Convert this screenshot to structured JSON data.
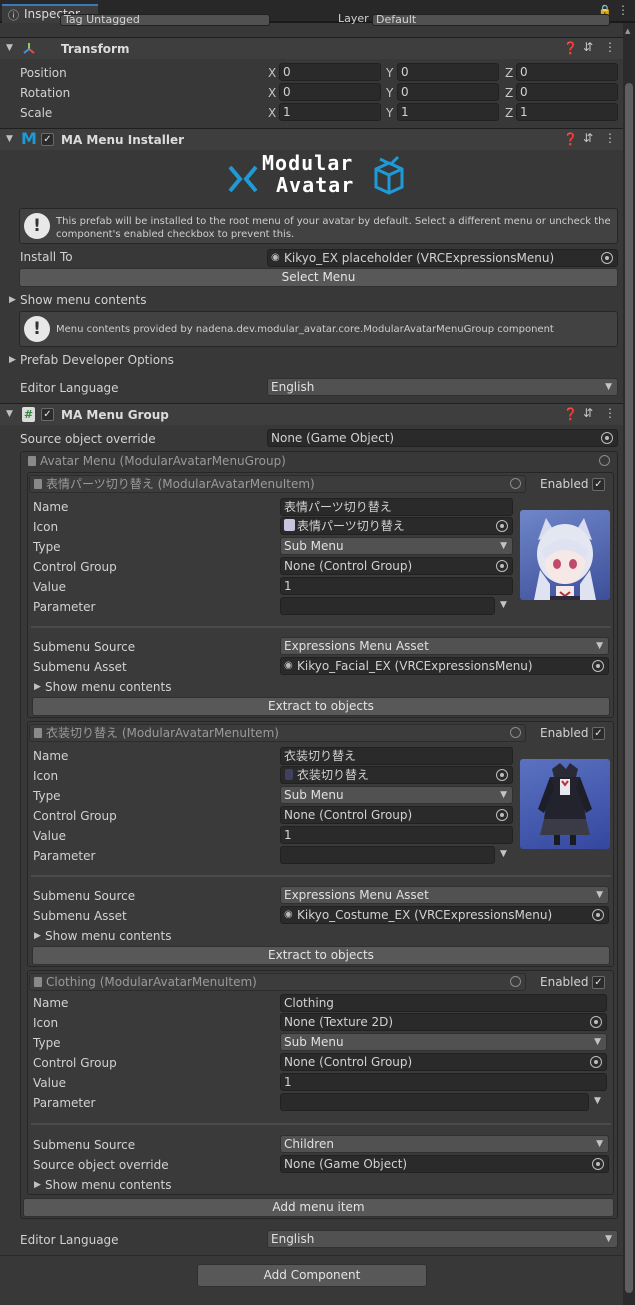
{
  "tab": {
    "title": "Inspector"
  },
  "top_partial": {
    "tag_text": "Tag  Untagged",
    "layer_label": "Layer",
    "layer_value": "Default"
  },
  "transform": {
    "title": "Transform",
    "rows": [
      {
        "label": "Position",
        "x": "0",
        "y": "0",
        "z": "0"
      },
      {
        "label": "Rotation",
        "x": "0",
        "y": "0",
        "z": "0"
      },
      {
        "label": "Scale",
        "x": "1",
        "y": "1",
        "z": "1"
      }
    ],
    "axis": {
      "x": "X",
      "y": "Y",
      "z": "Z"
    }
  },
  "installer": {
    "title": "MA Menu Installer",
    "logo_top": "Modular",
    "logo_bottom": "Avatar",
    "help1": "This prefab will be installed to the root menu of your avatar by default. Select a different menu or uncheck the component's enabled checkbox to prevent this.",
    "install_to_label": "Install To",
    "install_to_value": "Kikyo_EX placeholder (VRCExpressionsMenu)",
    "select_menu": "Select Menu",
    "show_menu_contents": "Show menu contents",
    "help2": "Menu contents provided by nadena.dev.modular_avatar.core.ModularAvatarMenuGroup component",
    "prefab_dev": "Prefab Developer Options",
    "editor_language_label": "Editor Language",
    "editor_language_value": "English"
  },
  "menu_group": {
    "title": "MA Menu Group",
    "source_override_label": "Source object override",
    "source_override_value": "None (Game Object)",
    "avatar_menu_header": "Avatar Menu (ModularAvatarMenuGroup)",
    "labels": {
      "name": "Name",
      "icon": "Icon",
      "type": "Type",
      "control_group": "Control Group",
      "value": "Value",
      "parameter": "Parameter",
      "submenu_source": "Submenu Source",
      "submenu_asset": "Submenu Asset",
      "source_override": "Source object override",
      "show_menu_contents": "Show menu contents",
      "enabled": "Enabled",
      "extract": "Extract to objects"
    },
    "items": [
      {
        "header": "表情パーツ切り替え (ModularAvatarMenuItem)",
        "name": "表情パーツ切り替え",
        "icon": "表情パーツ切り替え",
        "type": "Sub Menu",
        "control_group": "None (Control Group)",
        "value": "1",
        "parameter": "",
        "submenu_source": "Expressions Menu Asset",
        "submenu_asset": "Kikyo_Facial_EX (VRCExpressionsMenu)"
      },
      {
        "header": "衣装切り替え (ModularAvatarMenuItem)",
        "name": "衣装切り替え",
        "icon": "衣装切り替え",
        "type": "Sub Menu",
        "control_group": "None (Control Group)",
        "value": "1",
        "parameter": "",
        "submenu_source": "Expressions Menu Asset",
        "submenu_asset": "Kikyo_Costume_EX (VRCExpressionsMenu)"
      },
      {
        "header": "Clothing (ModularAvatarMenuItem)",
        "name": "Clothing",
        "icon": "None (Texture 2D)",
        "type": "Sub Menu",
        "control_group": "None (Control Group)",
        "value": "1",
        "parameter": "",
        "submenu_source": "Children",
        "source_override": "None (Game Object)"
      }
    ],
    "add_menu_item": "Add menu item",
    "editor_language_label": "Editor Language",
    "editor_language_value": "English"
  },
  "add_component": "Add Component",
  "colors": {
    "background": "#383838",
    "header": "#3e3e3e",
    "field": "#2a2a2a",
    "button": "#585858",
    "accent_blue": "#1e9bd7"
  }
}
